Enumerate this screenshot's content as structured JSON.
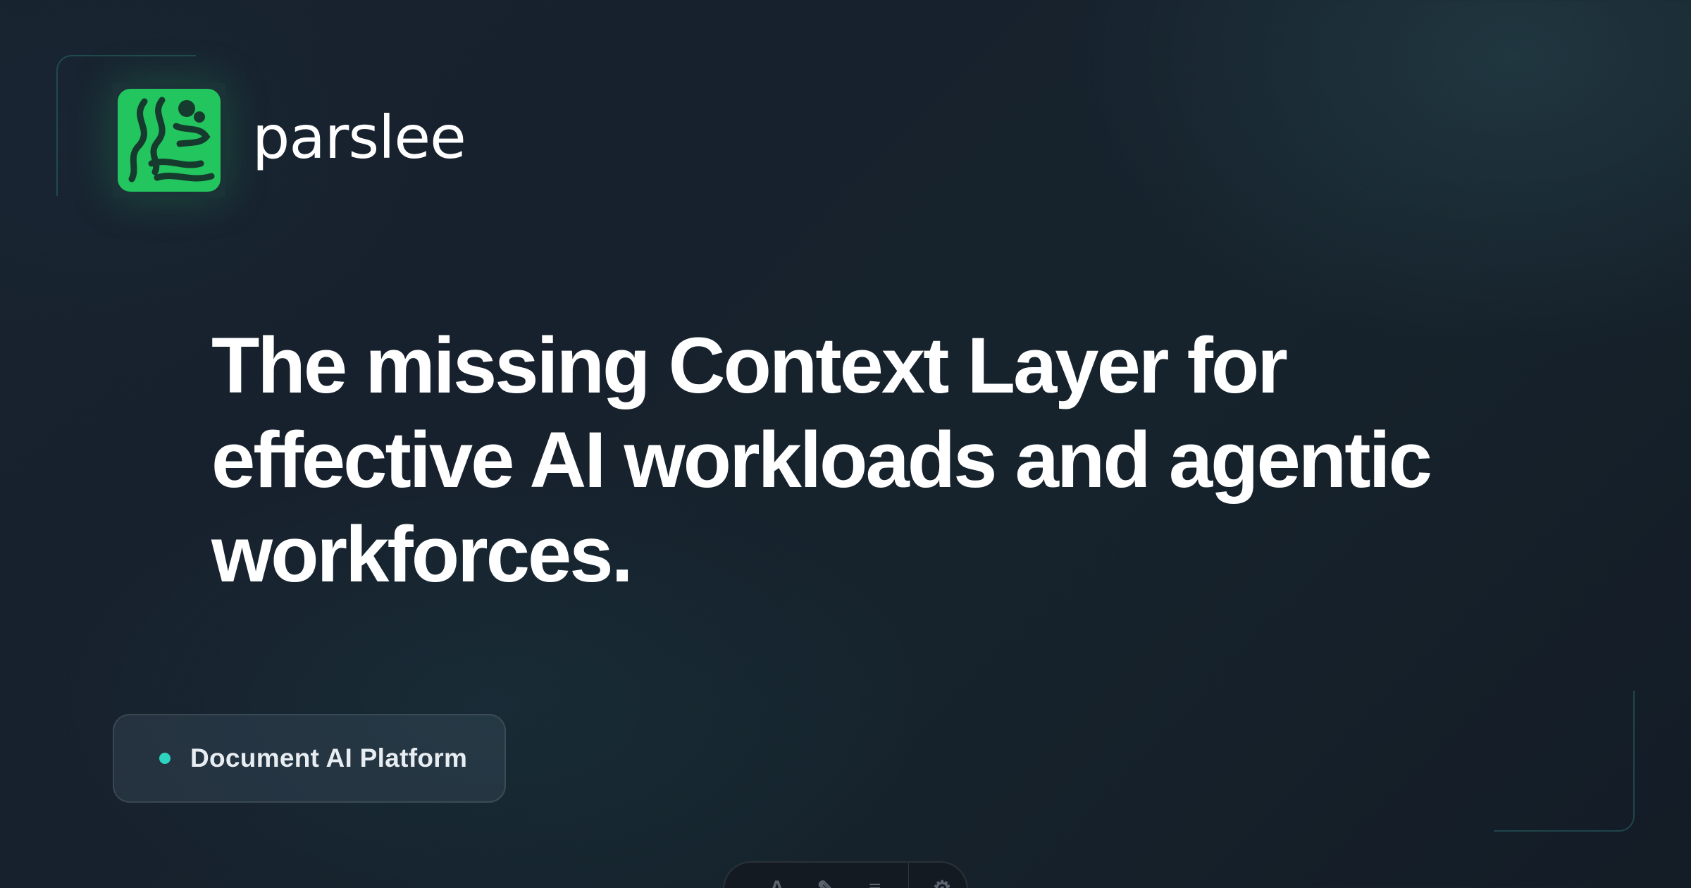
{
  "brand": {
    "name": "parslee",
    "logo_icon": "parslee-leaf-icon",
    "logo_color": "#22c55e"
  },
  "hero": {
    "headline_lines": [
      "The missing Context Layer for",
      "effective AI workloads and agentic",
      "workforces."
    ]
  },
  "badge": {
    "label": "Document AI Platform",
    "dot_color": "#2dd4bf"
  },
  "toolbar": {
    "items": [
      {
        "icon": "text-tool-icon",
        "glyph": "A"
      },
      {
        "icon": "highlighter-icon",
        "glyph": "✎"
      },
      {
        "icon": "menu-lines-icon",
        "glyph": "≡"
      },
      {
        "icon": "settings-gear-icon",
        "glyph": "⚙"
      }
    ]
  },
  "colors": {
    "background": "#17212d",
    "accent_green": "#22c55e",
    "accent_teal": "#2dd4bf",
    "frame_line": "#2d7878"
  }
}
